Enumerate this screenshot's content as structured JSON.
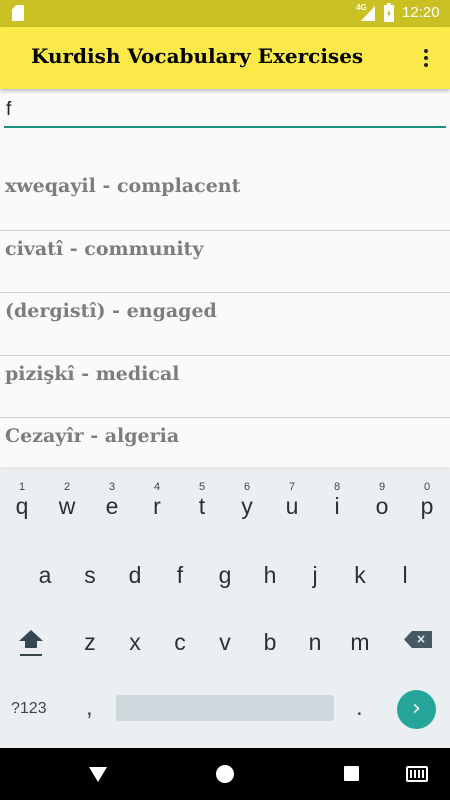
{
  "status_bar": {
    "network_label": "4G",
    "time": "12:20",
    "icons": [
      "sd-card-icon",
      "signal-icon",
      "battery-charging-icon"
    ]
  },
  "app_bar": {
    "title": "Kurdish Vocabulary Exercises",
    "menu_icon": "overflow-menu-icon"
  },
  "search": {
    "value": "f"
  },
  "results": [
    {
      "label": "xweqayil - complacent"
    },
    {
      "label": "civatî - community"
    },
    {
      "label": "(dergistî) - engaged"
    },
    {
      "label": "pizişkî - medical"
    },
    {
      "label": "Cezayîr - algeria"
    }
  ],
  "keyboard": {
    "row1": [
      {
        "key": "q",
        "hint": "1"
      },
      {
        "key": "w",
        "hint": "2"
      },
      {
        "key": "e",
        "hint": "3"
      },
      {
        "key": "r",
        "hint": "4"
      },
      {
        "key": "t",
        "hint": "5"
      },
      {
        "key": "y",
        "hint": "6"
      },
      {
        "key": "u",
        "hint": "7"
      },
      {
        "key": "i",
        "hint": "8"
      },
      {
        "key": "o",
        "hint": "9"
      },
      {
        "key": "p",
        "hint": "0"
      }
    ],
    "row2": [
      "a",
      "s",
      "d",
      "f",
      "g",
      "h",
      "j",
      "k",
      "l"
    ],
    "row3": [
      "z",
      "x",
      "c",
      "v",
      "b",
      "n",
      "m"
    ],
    "symbols_label": "?123",
    "comma": ",",
    "period": ".",
    "go_symbol": "›",
    "icons": [
      "shift-icon",
      "backspace-icon",
      "go-icon"
    ]
  },
  "nav_bar": {
    "icons": [
      "back-icon",
      "home-icon",
      "recents-icon",
      "keyboard-icon"
    ]
  }
}
